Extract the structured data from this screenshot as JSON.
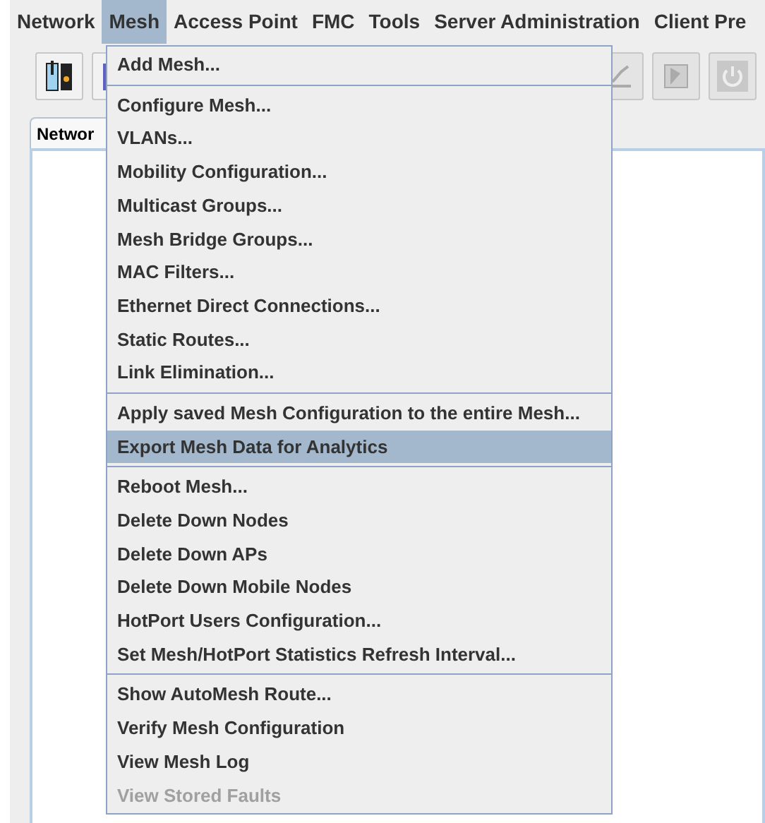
{
  "menubar": [
    {
      "label": "Network",
      "selected": false
    },
    {
      "label": "Mesh",
      "selected": true
    },
    {
      "label": "Access Point",
      "selected": false
    },
    {
      "label": "FMC",
      "selected": false
    },
    {
      "label": "Tools",
      "selected": false
    },
    {
      "label": "Server Administration",
      "selected": false
    },
    {
      "label": "Client Pre",
      "selected": false
    }
  ],
  "tab": {
    "label": "Networ"
  },
  "menu": {
    "sections": [
      [
        {
          "label": "Add Mesh...",
          "selected": false,
          "disabled": false
        }
      ],
      [
        {
          "label": "Configure Mesh...",
          "selected": false,
          "disabled": false
        },
        {
          "label": "VLANs...",
          "selected": false,
          "disabled": false
        },
        {
          "label": "Mobility Configuration...",
          "selected": false,
          "disabled": false
        },
        {
          "label": "Multicast Groups...",
          "selected": false,
          "disabled": false
        },
        {
          "label": "Mesh Bridge Groups...",
          "selected": false,
          "disabled": false
        },
        {
          "label": "MAC Filters...",
          "selected": false,
          "disabled": false
        },
        {
          "label": "Ethernet Direct Connections...",
          "selected": false,
          "disabled": false
        },
        {
          "label": "Static Routes...",
          "selected": false,
          "disabled": false
        },
        {
          "label": "Link Elimination...",
          "selected": false,
          "disabled": false
        }
      ],
      [
        {
          "label": "Apply saved Mesh Configuration to the entire Mesh...",
          "selected": false,
          "disabled": false
        },
        {
          "label": "Export Mesh Data for Analytics",
          "selected": true,
          "disabled": false
        }
      ],
      [
        {
          "label": "Reboot Mesh...",
          "selected": false,
          "disabled": false
        },
        {
          "label": "Delete Down Nodes",
          "selected": false,
          "disabled": false
        },
        {
          "label": "Delete Down APs",
          "selected": false,
          "disabled": false
        },
        {
          "label": "Delete Down Mobile Nodes",
          "selected": false,
          "disabled": false
        },
        {
          "label": "HotPort Users Configuration...",
          "selected": false,
          "disabled": false
        },
        {
          "label": "Set Mesh/HotPort Statistics Refresh Interval...",
          "selected": false,
          "disabled": false
        }
      ],
      [
        {
          "label": "Show AutoMesh Route...",
          "selected": false,
          "disabled": false
        },
        {
          "label": "Verify Mesh Configuration",
          "selected": false,
          "disabled": false
        },
        {
          "label": "View Mesh Log",
          "selected": false,
          "disabled": false
        },
        {
          "label": "View Stored Faults",
          "selected": false,
          "disabled": true
        }
      ]
    ]
  }
}
